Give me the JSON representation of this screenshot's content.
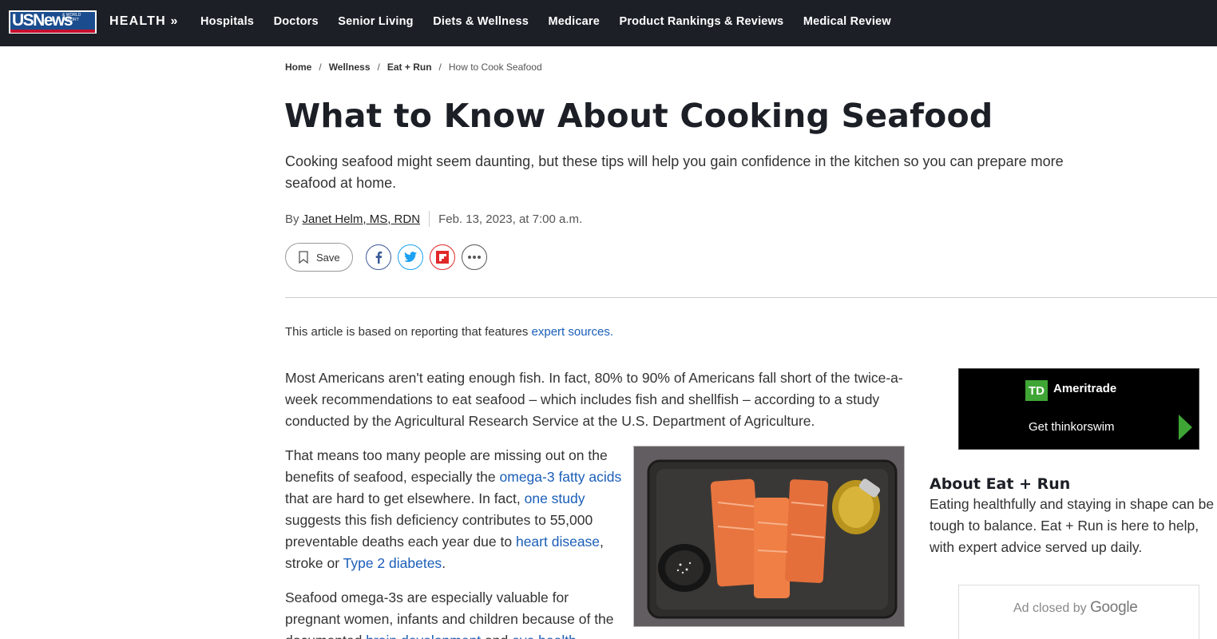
{
  "topnav": {
    "logo_text": "USNews",
    "logo_small": "& WORLD REPORT",
    "section": "HEALTH »",
    "items": [
      {
        "label": "Hospitals"
      },
      {
        "label": "Doctors"
      },
      {
        "label": "Senior Living"
      },
      {
        "label": "Diets & Wellness"
      },
      {
        "label": "Medicare"
      },
      {
        "label": "Product Rankings & Reviews"
      },
      {
        "label": "Medical Review"
      }
    ]
  },
  "breadcrumb": {
    "items": [
      "Home",
      "Wellness",
      "Eat + Run"
    ],
    "current": "How to Cook Seafood",
    "separator": "/"
  },
  "article": {
    "title": "What to Know About Cooking Seafood",
    "subtitle": "Cooking seafood might seem daunting, but these tips will help you gain confidence in the kitchen so you can prepare more seafood at home.",
    "byline_prefix": "By",
    "author": "Janet Helm, MS, RDN",
    "date": "Feb. 13, 2023, at 7:00 a.m.",
    "save_label": "Save",
    "sources_note": "This article is based on reporting that features",
    "sources_link": "expert sources.",
    "p1": "Most Americans aren't eating enough fish. In fact, 80% to 90% of Americans fall short of the twice-a-week recommendations to eat seafood – which includes fish and shellfish – according to a study conducted by the Agricultural Research Service at the U.S. Department of Agriculture.",
    "p2": {
      "t1": "That means too many people are missing out on the benefits of seafood, especially the ",
      "l1": "omega-3 fatty acids",
      "t2": " that are hard to get elsewhere. In fact, ",
      "l2": "one study",
      "t3": " suggests this fish deficiency contributes to 55,000 preventable deaths each year due to ",
      "l3": "heart disease",
      "t4": ", stroke or ",
      "l4": "Type 2 diabetes",
      "t5": "."
    },
    "p3": {
      "t1": "Seafood omega-3s are especially valuable for pregnant women, infants and children because of the documented ",
      "l1": "brain development",
      "t2": " and ",
      "l2": "eye health"
    }
  },
  "sidebar": {
    "ad_brand": "Ameritrade",
    "ad_logo": "TD",
    "ad_cta": "Get thinkorswim",
    "about_title": "About Eat + Run",
    "about_lines": [
      "Eating healthfully and staying in shape can be",
      "tough to balance. Eat + Run is here to help,",
      "with expert advice served up daily."
    ],
    "ad_closed_text": "Ad closed by",
    "ad_closed_brand": "Google"
  },
  "colors": {
    "nav_bg": "#1c1f26",
    "link": "#1a5eb8",
    "td_green": "#3fa535",
    "facebook": "#3b5998",
    "twitter": "#1da1f2",
    "flipboard": "#e12828"
  },
  "icons": [
    "bookmark-icon",
    "facebook-icon",
    "twitter-icon",
    "flipboard-icon",
    "more-icon"
  ]
}
